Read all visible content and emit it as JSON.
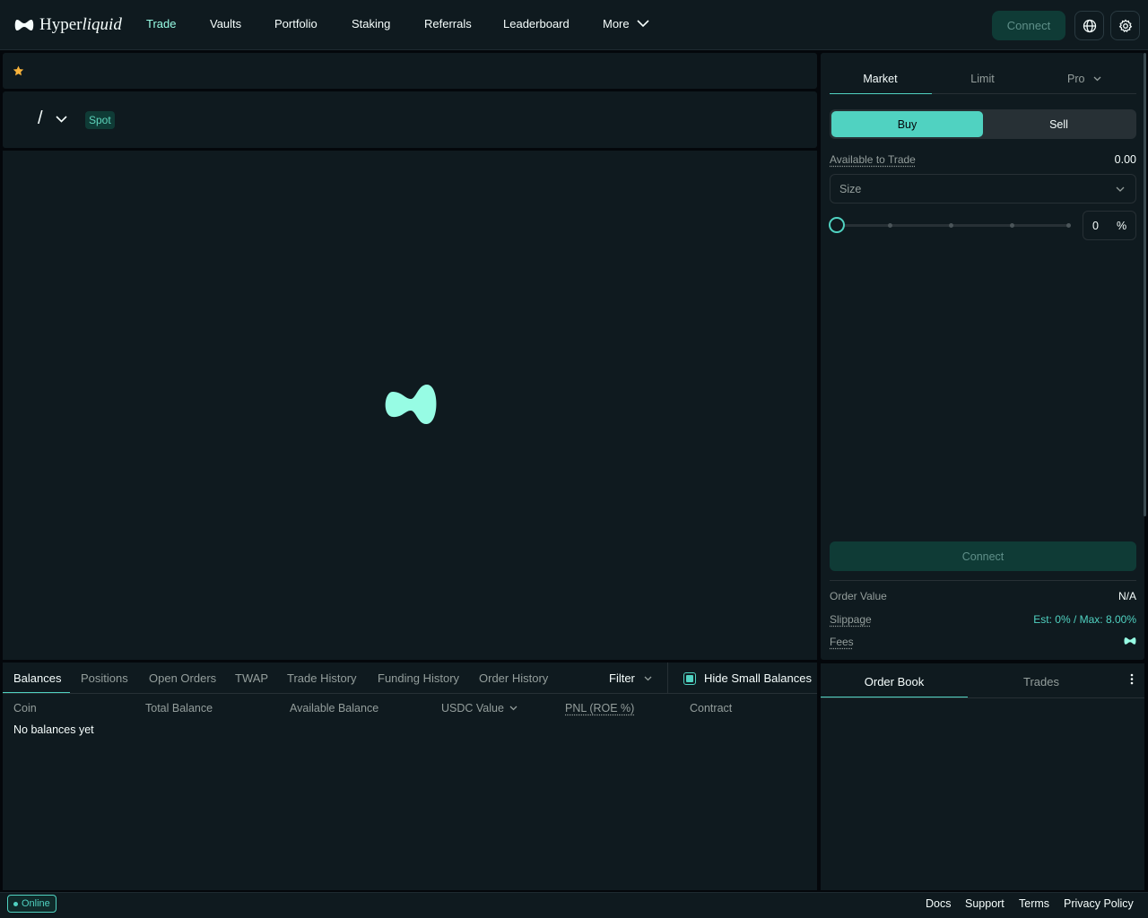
{
  "header": {
    "logo_text": "Hyperliquid",
    "nav": [
      "Trade",
      "Vaults",
      "Portfolio",
      "Staking",
      "Referrals",
      "Leaderboard"
    ],
    "more_label": "More",
    "connect_label": "Connect"
  },
  "market": {
    "pair_separator": "/",
    "type_badge": "Spot"
  },
  "order": {
    "tabs": [
      "Market",
      "Limit"
    ],
    "pro_label": "Pro",
    "buy_label": "Buy",
    "sell_label": "Sell",
    "available_label": "Available to Trade",
    "available_value": "0.00",
    "size_placeholder": "Size",
    "percent_value": "0",
    "percent_unit": "%",
    "slider_level_percent": 0,
    "connect_label": "Connect",
    "order_value_label": "Order Value",
    "order_value": "N/A",
    "slippage_label": "Slippage",
    "slippage_value": "Est: 0% / Max: 8.00%",
    "fees_label": "Fees"
  },
  "bottom": {
    "tabs": [
      "Balances",
      "Positions",
      "Open Orders",
      "TWAP",
      "Trade History",
      "Funding History",
      "Order History"
    ],
    "filter_label": "Filter",
    "hide_small_label": "Hide Small Balances",
    "hide_small_checked": true,
    "columns": [
      "Coin",
      "Total Balance",
      "Available Balance",
      "USDC Value",
      "PNL (ROE %)",
      "Contract"
    ],
    "empty_text": "No balances yet"
  },
  "book": {
    "tabs": [
      "Order Book",
      "Trades"
    ]
  },
  "footer": {
    "status": "Online",
    "links": [
      "Docs",
      "Support",
      "Terms",
      "Privacy Policy"
    ]
  },
  "colors": {
    "accent": "#50d2c1",
    "accent_light": "#97fce4",
    "panel": "#0f1a1f",
    "connect_bg": "#0f3b36"
  }
}
